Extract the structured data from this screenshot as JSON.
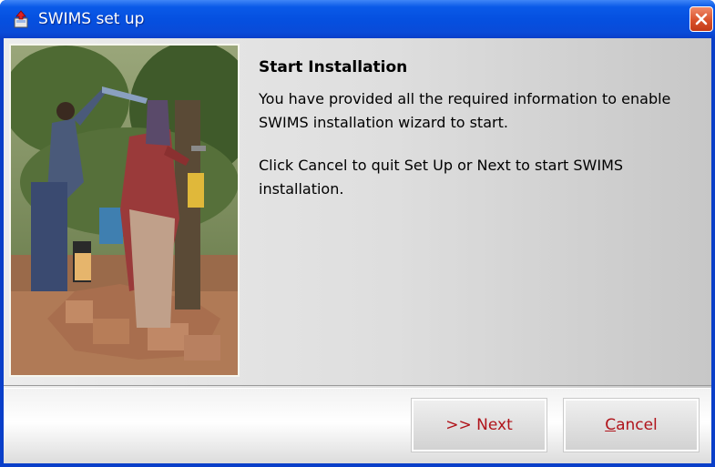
{
  "window": {
    "title": "SWIMS set up",
    "icons": {
      "app": "installer-icon",
      "close": "close-icon"
    }
  },
  "content": {
    "image": "water-point-photo",
    "heading": "Start Installation",
    "paragraph1": "You have provided all the required information to enable SWIMS installation wizard to start.",
    "paragraph2": "Click Cancel to quit Set Up or Next to start SWIMS installation."
  },
  "buttons": {
    "next_label": ">> Next",
    "cancel_first": "C",
    "cancel_rest": "ancel"
  },
  "colors": {
    "titlebar": "#0550e0",
    "button_text": "#b0131a",
    "close_button": "#d9512b"
  }
}
